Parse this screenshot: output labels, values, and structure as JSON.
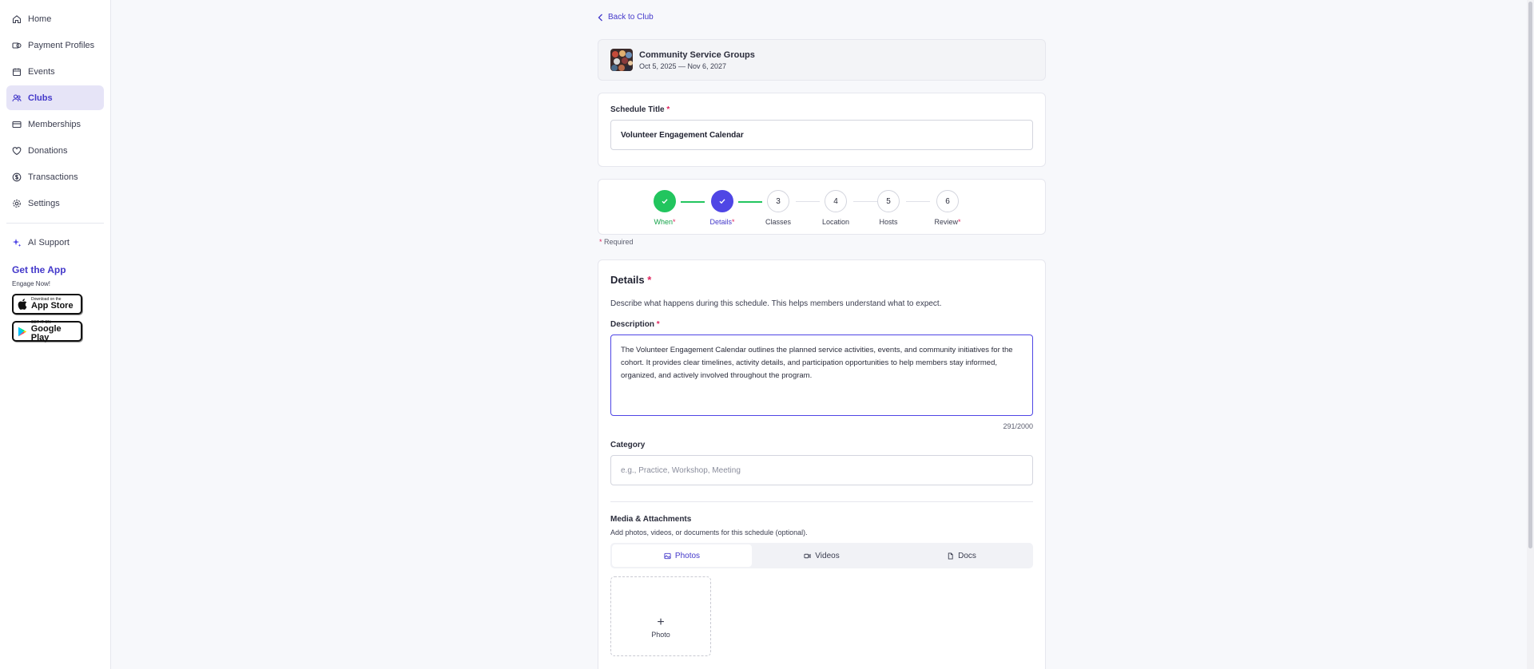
{
  "sidebar": {
    "items": [
      {
        "label": "Home",
        "icon": "home-icon"
      },
      {
        "label": "Payment Profiles",
        "icon": "payment-icon"
      },
      {
        "label": "Events",
        "icon": "calendar-icon"
      },
      {
        "label": "Clubs",
        "icon": "people-icon",
        "active": true
      },
      {
        "label": "Memberships",
        "icon": "card-icon"
      },
      {
        "label": "Donations",
        "icon": "heart-icon"
      },
      {
        "label": "Transactions",
        "icon": "dollar-icon"
      },
      {
        "label": "Settings",
        "icon": "gear-icon"
      }
    ],
    "ai_support": "AI Support",
    "get_app_title": "Get the App",
    "get_app_sub": "Engage Now!",
    "app_store_small": "Download on the",
    "app_store_big": "App Store",
    "google_play_small": "GET IT ON",
    "google_play_big": "Google Play"
  },
  "back_link": "Back to Club",
  "club": {
    "name": "Community Service Groups",
    "dates": "Oct 5, 2025 — Nov 6, 2027"
  },
  "schedule_title": {
    "label": "Schedule Title",
    "required_mark": "*",
    "value": "Volunteer Engagement Calendar"
  },
  "stepper": {
    "steps": [
      {
        "number": "1",
        "label": "When",
        "required": "*",
        "state": "done"
      },
      {
        "number": "2",
        "label": "Details",
        "required": "*",
        "state": "current"
      },
      {
        "number": "3",
        "label": "Classes",
        "required": "",
        "state": "pending"
      },
      {
        "number": "4",
        "label": "Location",
        "required": "",
        "state": "pending"
      },
      {
        "number": "5",
        "label": "Hosts",
        "required": "",
        "state": "pending"
      },
      {
        "number": "6",
        "label": "Review",
        "required": "*",
        "state": "pending"
      }
    ]
  },
  "required_note": {
    "mark": "*",
    "text": " Required"
  },
  "details": {
    "heading": "Details",
    "required_mark": "*",
    "description": "Describe what happens during this schedule. This helps members understand what to expect.",
    "desc_label": "Description",
    "desc_value": "The Volunteer Engagement Calendar outlines the planned service activities, events, and community initiatives for the cohort. It provides clear timelines, activity details, and participation opportunities to help members stay informed, organized, and actively involved throughout the program.",
    "counter": "291/2000",
    "category_label": "Category",
    "category_placeholder": "e.g., Practice, Workshop, Meeting",
    "media_title": "Media & Attachments",
    "media_sub": "Add photos, videos, or documents for this schedule (optional).",
    "tabs": [
      {
        "label": "Photos",
        "icon": "image-icon",
        "active": true
      },
      {
        "label": "Videos",
        "icon": "video-icon",
        "active": false
      },
      {
        "label": "Docs",
        "icon": "document-icon",
        "active": false
      }
    ],
    "upload_label": "Photo",
    "upload_plus": "+"
  },
  "colors": {
    "accent": "#4f46e5",
    "accent_text": "#4338ca",
    "success": "#22c55e",
    "required": "#e0245e"
  }
}
